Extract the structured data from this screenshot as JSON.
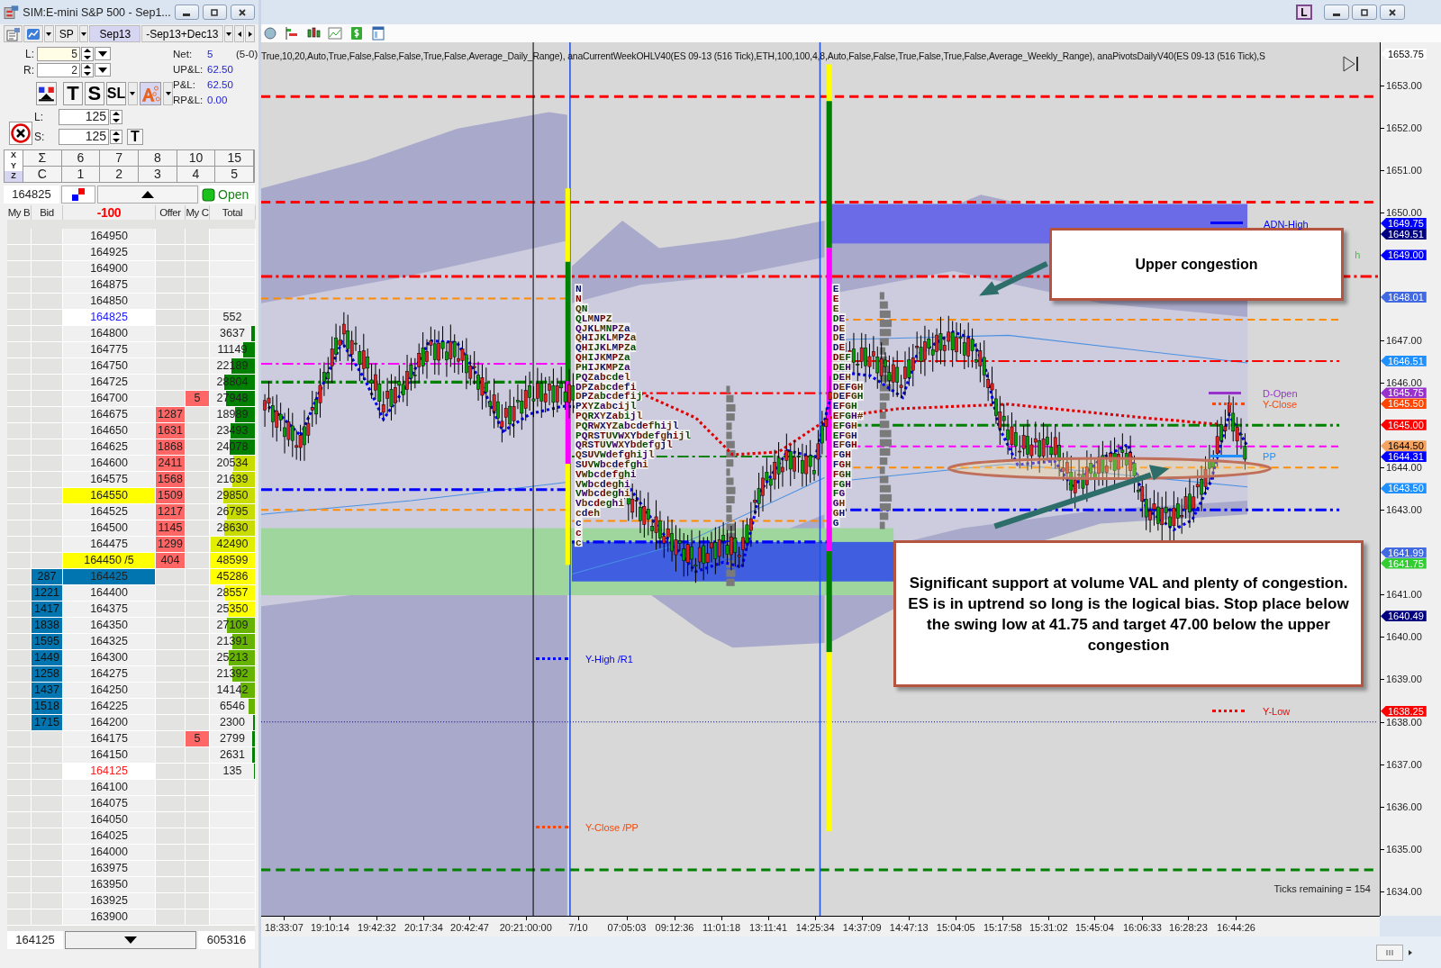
{
  "dom_window": {
    "title": "SIM:E-mini S&P 500 - Sep1..."
  },
  "instrument_bar": {
    "instrument": "SP",
    "tabs": [
      {
        "label": "Sep13",
        "selected": true
      },
      {
        "label": "-Sep13+Dec13",
        "selected": false
      }
    ]
  },
  "order_controls": {
    "fields": [
      {
        "label": "L:",
        "value": "5",
        "focused": true
      },
      {
        "label": "R:",
        "value": "2",
        "focused": false
      }
    ],
    "strategy_buttons": [
      "T",
      "S",
      "SL"
    ],
    "targets": [
      {
        "label": "L:",
        "value": "125"
      },
      {
        "label": "S:",
        "value": "125"
      }
    ],
    "target_button": "T",
    "stats": [
      {
        "label": "Net:",
        "value": "5",
        "extra": "(5-0)"
      },
      {
        "label": "UP&L:",
        "value": "62.50"
      },
      {
        "label": "P&L:",
        "value": "62.50"
      },
      {
        "label": "RP&L:",
        "value": "0.00"
      }
    ]
  },
  "xyz": {
    "row_labels": [
      {
        "label": "X",
        "selected": false
      },
      {
        "label": "Y",
        "selected": false
      },
      {
        "label": "Z",
        "selected": true
      }
    ],
    "rows": [
      [
        "Σ",
        "6",
        "7",
        "8",
        "10",
        "15"
      ],
      [
        "C",
        "1",
        "2",
        "3",
        "4",
        "5"
      ]
    ]
  },
  "info": {
    "price": "164825",
    "status": "Open"
  },
  "ladder": {
    "columns": [
      "My B",
      "Bid",
      "-100",
      "Offer",
      "My C",
      "Total"
    ],
    "rows": [
      {
        "price": "164950",
        "kind": "plain"
      },
      {
        "price": "164925",
        "kind": "plain"
      },
      {
        "price": "164900",
        "kind": "plain"
      },
      {
        "price": "164875",
        "kind": "plain"
      },
      {
        "price": "164850",
        "kind": "plain"
      },
      {
        "price": "164825",
        "kind": "high",
        "total": "552"
      },
      {
        "price": "164800",
        "kind": "plain",
        "total": "3637",
        "level": 0.08,
        "color": "#008000"
      },
      {
        "price": "164775",
        "kind": "plain",
        "total": "11149",
        "level": 0.26,
        "color": "#008000"
      },
      {
        "price": "164750",
        "kind": "plain",
        "total": "22189",
        "level": 0.53,
        "color": "#008000"
      },
      {
        "price": "164725",
        "kind": "plain",
        "total": "28804",
        "level": 0.68,
        "color": "#008000"
      },
      {
        "price": "164700",
        "kind": "plain",
        "my_order": "5",
        "total": "27948",
        "level": 0.65,
        "color": "#008000"
      },
      {
        "price": "164675",
        "kind": "plain",
        "offer": "1287",
        "total": "18989",
        "level": 0.45,
        "color": "#008000"
      },
      {
        "price": "164650",
        "kind": "plain",
        "offer": "1631",
        "total": "23493",
        "level": 0.55,
        "color": "#008000"
      },
      {
        "price": "164625",
        "kind": "plain",
        "offer": "1868",
        "total": "24078",
        "level": 0.56,
        "color": "#008000"
      },
      {
        "price": "164600",
        "kind": "plain",
        "offer": "2411",
        "total": "20534",
        "level": 0.48,
        "color": "#c8dc00"
      },
      {
        "price": "164575",
        "kind": "plain",
        "offer": "1568",
        "total": "21639",
        "level": 0.5,
        "color": "#c8dc00"
      },
      {
        "price": "164550",
        "kind": "marked",
        "offer": "1509",
        "total": "29850",
        "level": 0.7,
        "color": "#c8dc00"
      },
      {
        "price": "164525",
        "kind": "plain",
        "offer": "1217",
        "total": "26795",
        "level": 0.63,
        "color": "#c8dc00"
      },
      {
        "price": "164500",
        "kind": "plain",
        "offer": "1145",
        "total": "28630",
        "level": 0.69,
        "color": "#c8dc00"
      },
      {
        "price": "164475",
        "kind": "plain",
        "offer": "1299",
        "total": "42490",
        "level": 0.98,
        "color": "#e2ee00"
      },
      {
        "price": "164450 /5",
        "kind": "marked",
        "offer": "404",
        "total": "48599",
        "level": 1,
        "color": "#ffff00"
      },
      {
        "price": "164425",
        "kind": "bid",
        "bid": "287",
        "total": "45286",
        "level": 1,
        "color": "#ffff00"
      },
      {
        "price": "164400",
        "kind": "plain",
        "bid": "1221",
        "total": "28557",
        "level": 0.66,
        "color": "#ffff00"
      },
      {
        "price": "164375",
        "kind": "plain",
        "bid": "1417",
        "total": "25350",
        "level": 0.6,
        "color": "#ffff00"
      },
      {
        "price": "164350",
        "kind": "plain",
        "bid": "1838",
        "total": "27109",
        "level": 0.62,
        "color": "#66b300"
      },
      {
        "price": "164325",
        "kind": "plain",
        "bid": "1595",
        "total": "21391",
        "level": 0.5,
        "color": "#66b300"
      },
      {
        "price": "164300",
        "kind": "plain",
        "bid": "1449",
        "total": "25213",
        "level": 0.58,
        "color": "#66b300"
      },
      {
        "price": "164275",
        "kind": "plain",
        "bid": "1258",
        "total": "21392",
        "level": 0.5,
        "color": "#66b300"
      },
      {
        "price": "164250",
        "kind": "plain",
        "bid": "1437",
        "total": "14142",
        "level": 0.33,
        "color": "#66b300"
      },
      {
        "price": "164225",
        "kind": "plain",
        "bid": "1518",
        "total": "6546",
        "level": 0.15,
        "color": "#66b300"
      },
      {
        "price": "164200",
        "kind": "plain",
        "bid": "1715",
        "total": "2300",
        "level": 0.04,
        "color": "#008000"
      },
      {
        "price": "164175",
        "kind": "plain",
        "my_order": "5",
        "total": "2799",
        "level": 0.06,
        "color": "#008000"
      },
      {
        "price": "164150",
        "kind": "plain",
        "total": "2631",
        "level": 0.06,
        "color": "#008000"
      },
      {
        "price": "164125",
        "kind": "low",
        "total": "135",
        "level": 0.02,
        "color": "#008000"
      },
      {
        "price": "164100",
        "kind": "plain"
      },
      {
        "price": "164075",
        "kind": "plain"
      },
      {
        "price": "164050",
        "kind": "plain"
      },
      {
        "price": "164025",
        "kind": "plain"
      },
      {
        "price": "164000",
        "kind": "plain"
      },
      {
        "price": "163975",
        "kind": "plain"
      },
      {
        "price": "163950",
        "kind": "plain"
      },
      {
        "price": "163925",
        "kind": "plain"
      },
      {
        "price": "163900",
        "kind": "plain"
      }
    ]
  },
  "footer": {
    "price": "164125",
    "total": "605316"
  },
  "chart_window": {
    "link_button": "L"
  },
  "chart": {
    "indicator_text": "True,10,20,Auto,True,False,False,False,True,False,Average_Daily_Range), anaCurrentWeekOHLV40(ES 09-13 (516 Tick),ETH,100,100,4,8,Auto,False,False,True,False,True,False,Average_Weekly_Range), anaPivotsDailyV40(ES 09-13 (516 Tick),S",
    "y_axis": [
      "1653.00",
      "1652.00",
      "1651.00",
      "1650.00",
      "1647.00",
      "1646.00",
      "1644.00",
      "1643.00",
      "1641.00",
      "1640.00",
      "1639.00",
      "1638.00",
      "1637.00",
      "1636.00",
      "1635.00",
      "1634.00"
    ],
    "price_tags": [
      {
        "text": "1653.75",
        "color": "#ffffff"
      },
      {
        "text": "1649.75",
        "color": "#0000ff"
      },
      {
        "text": "1649.51",
        "color": "#000080"
      },
      {
        "text": "1649.00",
        "color": "#0000ff"
      },
      {
        "text": "1648.01",
        "color": "#4169e1"
      },
      {
        "text": "1646.51",
        "color": "#1e90ff"
      },
      {
        "text": "1645.75",
        "color": "#9932cc"
      },
      {
        "text": "1645.50",
        "color": "#ff4500"
      },
      {
        "text": "1645.00",
        "color": "#ff0000"
      },
      {
        "text": "1644.50",
        "color": "#f4a460"
      },
      {
        "text": "1644.31",
        "color": "#0000ff"
      },
      {
        "text": "1643.50",
        "color": "#1e90ff"
      },
      {
        "text": "1641.99",
        "color": "#4169e1"
      },
      {
        "text": "1641.75",
        "color": "#32cd32"
      },
      {
        "text": "1640.49",
        "color": "#000080"
      },
      {
        "text": "1638.25",
        "color": "#ff0000"
      }
    ],
    "level_labels": [
      {
        "text": "ADN-High",
        "color": "#0000ff"
      },
      {
        "text": "h",
        "color": "#32cd32"
      },
      {
        "text": "D-Open",
        "color": "#9932cc"
      },
      {
        "text": "Y-Close",
        "color": "#ff4500"
      },
      {
        "text": "PP",
        "color": "#1e90ff"
      },
      {
        "text": "Y-High /R1",
        "color": "#0000ff"
      },
      {
        "text": "Y-Close /PP",
        "color": "#ff4500"
      },
      {
        "text": "Y-Low",
        "color": "#ff0000"
      }
    ],
    "tpo_profiles": [
      [
        "N",
        "N",
        "QN",
        "QLMNPZ",
        "QJKLMNPZa",
        "QHIJKLMPZa",
        "QHIJKLMPZa",
        "QHIJKMPZa",
        "PHIJKMPZa",
        "PQZabcdel",
        "DPZabcdefi",
        "DPZabcdefij",
        "PXYZabcijl",
        "PQRXYZabijl",
        "PQRWXYZabcdefhijl",
        "PQRSTUVWXYbdefghijl",
        "QRSTUVWXYbdefgjl",
        "QSUVWdefghijl",
        "SUVWbcdefghi",
        "VWbcdefghi",
        "VWbcdeghi",
        "VWbcdeghi",
        "Vbcdeghi",
        "cdeh",
        "c",
        "c",
        "c"
      ],
      [
        "E",
        "E",
        "E",
        "DE",
        "DE",
        "DE",
        "DE",
        "DEF",
        "DEH",
        "DEH",
        "DEFGH",
        "DEFGH",
        "EFGH",
        "EFGH#",
        "EFGH",
        "EFGH",
        "EFGH",
        "FGH",
        "FGH",
        "FGH",
        "FGH",
        "FG",
        "GH",
        "GH",
        "G"
      ]
    ],
    "ticks_remaining": "Ticks remaining = 154",
    "annotations": [
      {
        "text": "Upper congestion"
      },
      {
        "text": "Significant support at volume VAL and plenty of congestion. ES is in uptrend so long is the logical bias. Stop place below the swing low at 41.75 and target 47.00 below the upper congestion"
      }
    ],
    "time_labels": [
      "18:33:07",
      "19:10:14",
      "19:42:32",
      "20:17:34",
      "20:42:47",
      "20:21:00:00",
      "7/10",
      "07:05:03",
      "09:12:36",
      "11:01:18",
      "13:11:41",
      "14:25:34",
      "14:37:09",
      "14:47:13",
      "15:04:05",
      "15:17:58",
      "15:31:02",
      "15:45:04",
      "16:06:33",
      "16:28:23",
      "16:44:26"
    ]
  }
}
